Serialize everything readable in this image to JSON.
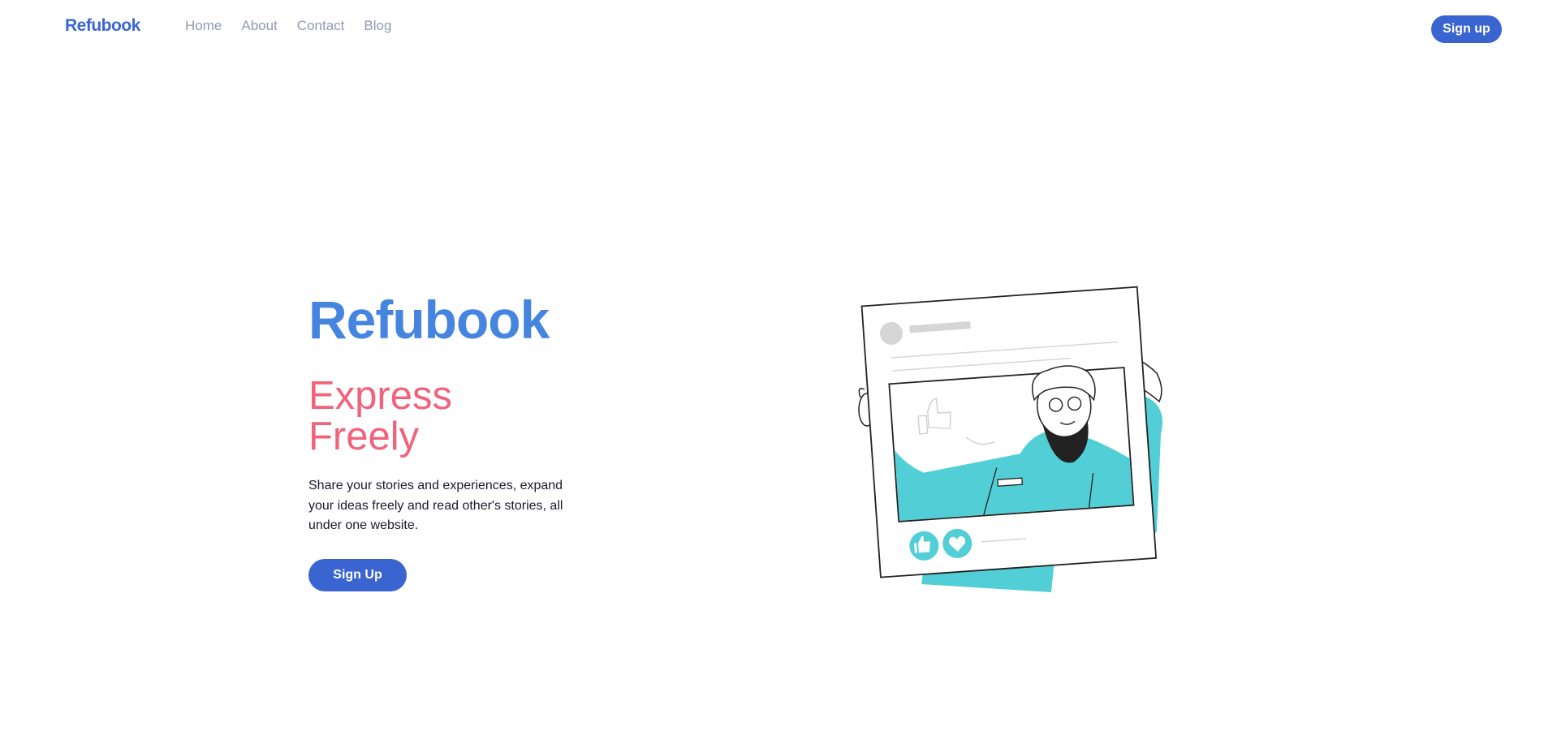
{
  "nav": {
    "brand": "Refubook",
    "links": [
      "Home",
      "About",
      "Contact",
      "Blog"
    ],
    "signup_label": "Sign up"
  },
  "hero": {
    "title": "Refubook",
    "tagline": "Express Freely",
    "description": "Share your stories and experiences, expand your ideas freely and read other's stories, all under one website.",
    "signup_label": "Sign Up"
  },
  "colors": {
    "brand_blue": "#3a67d4",
    "title_blue": "#4585df",
    "tagline_pink": "#f0637b",
    "nav_link_gray": "#8f9bb5",
    "illustration_teal": "#52cfd6"
  },
  "illustration": {
    "icons": [
      "thumbs-up-icon",
      "heart-icon"
    ]
  }
}
